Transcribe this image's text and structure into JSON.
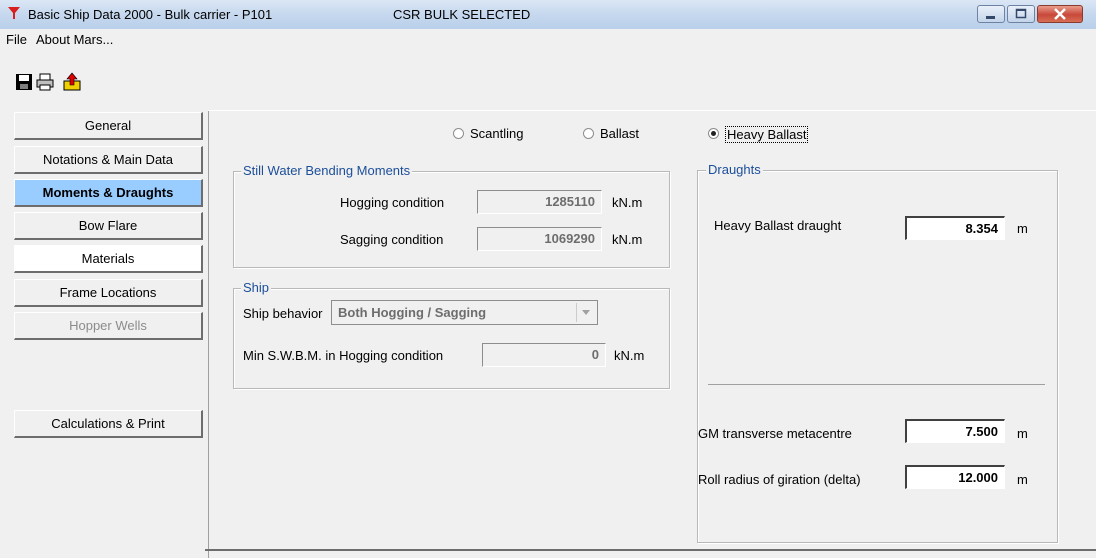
{
  "window": {
    "title": "Basic Ship Data 2000 - Bulk carrier - P101",
    "status": "CSR BULK SELECTED"
  },
  "menu": {
    "file": "File",
    "about": "About Mars..."
  },
  "toolbar": {
    "icons": [
      "save-icon",
      "print-icon",
      "export-icon"
    ]
  },
  "nav": [
    {
      "label": "General"
    },
    {
      "label": "Notations & Main Data"
    },
    {
      "label": "Moments & Draughts"
    },
    {
      "label": "Bow Flare"
    },
    {
      "label": "Materials"
    },
    {
      "label": "Frame Locations"
    },
    {
      "label": "Hopper Wells"
    },
    {
      "label": "Calculations & Print"
    }
  ],
  "radios": {
    "scantling": "Scantling",
    "ballast": "Ballast",
    "heavy_ballast": "Heavy Ballast",
    "selected": "Heavy Ballast"
  },
  "swbm": {
    "title": "Still Water Bending Moments",
    "hogging_label": "Hogging condition",
    "hogging_value": "1285110",
    "sagging_label": "Sagging  condition",
    "sagging_value": "1069290",
    "unit": "kN.m"
  },
  "ship": {
    "title": "Ship",
    "behavior_label": "Ship behavior",
    "behavior_value": "Both Hogging / Sagging",
    "min_label": "Min S.W.B.M. in Hogging condition",
    "min_value": "0",
    "unit": "kN.m"
  },
  "draughts": {
    "title": "Draughts",
    "hb_label": "Heavy Ballast draught",
    "hb_value": "8.354",
    "gm_label": "GM transverse metacentre",
    "gm_value": "7.500",
    "roll_label": "Roll radius of giration (delta)",
    "roll_value": "12.000",
    "unit": "m"
  }
}
